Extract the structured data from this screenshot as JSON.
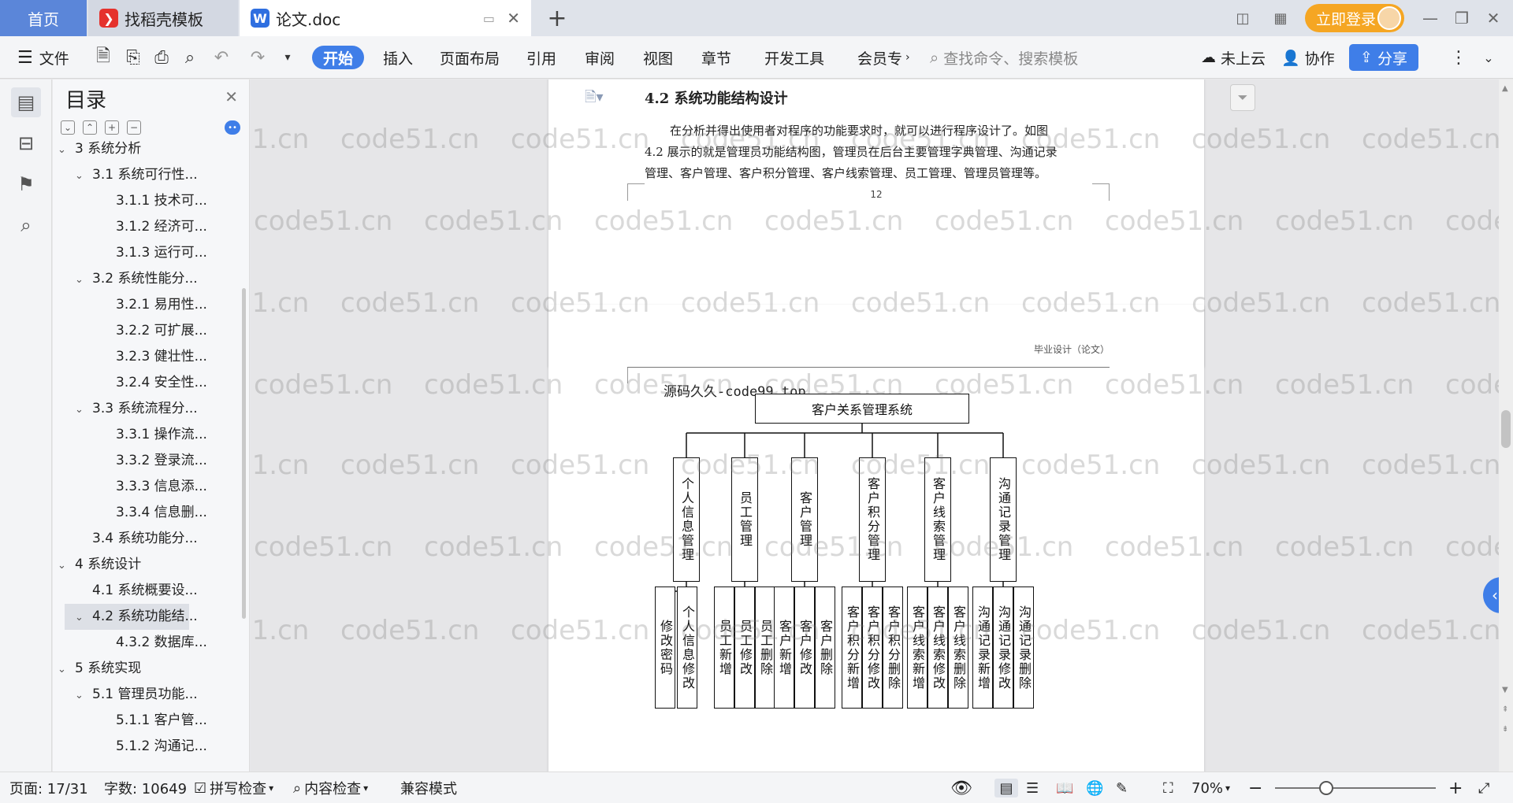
{
  "tabs": {
    "home": "首页",
    "docer": "找稻壳模板",
    "doc": "论文.doc"
  },
  "login": "立即登录",
  "toolbar": {
    "file": "文件",
    "start": "开始",
    "insert": "插入",
    "layout": "页面布局",
    "reference": "引用",
    "review": "审阅",
    "view": "视图",
    "chapter": "章节",
    "devtools": "开发工具",
    "member": "会员专",
    "search_placeholder": "查找命令、搜索模板",
    "cloud": "未上云",
    "collab": "协作",
    "share": "分享"
  },
  "toc": {
    "title": "目录",
    "items": [
      {
        "label": "3  系统分析",
        "level": 1,
        "caret": "v"
      },
      {
        "label": "3.1  系统可行性...",
        "level": 2,
        "caret": "v"
      },
      {
        "label": "3.1.1  技术可...",
        "level": 3,
        "caret": ""
      },
      {
        "label": "3.1.2  经济可...",
        "level": 3,
        "caret": ""
      },
      {
        "label": "3.1.3  运行可...",
        "level": 3,
        "caret": ""
      },
      {
        "label": "3.2  系统性能分...",
        "level": 2,
        "caret": "v"
      },
      {
        "label": "3.2.1  易用性...",
        "level": 3,
        "caret": ""
      },
      {
        "label": "3.2.2  可扩展...",
        "level": 3,
        "caret": ""
      },
      {
        "label": "3.2.3  健壮性...",
        "level": 3,
        "caret": ""
      },
      {
        "label": "3.2.4  安全性...",
        "level": 3,
        "caret": ""
      },
      {
        "label": "3.3  系统流程分...",
        "level": 2,
        "caret": "v"
      },
      {
        "label": "3.3.1  操作流...",
        "level": 3,
        "caret": ""
      },
      {
        "label": "3.3.2  登录流...",
        "level": 3,
        "caret": ""
      },
      {
        "label": "3.3.3  信息添...",
        "level": 3,
        "caret": ""
      },
      {
        "label": "3.3.4  信息删...",
        "level": 3,
        "caret": ""
      },
      {
        "label": "3.4  系统功能分...",
        "level": 2,
        "caret": ""
      },
      {
        "label": "4  系统设计",
        "level": 1,
        "caret": "v"
      },
      {
        "label": "4.1  系统概要设...",
        "level": 2,
        "caret": ""
      },
      {
        "label": "4.2  系统功能结...",
        "level": 2,
        "caret": "v",
        "selected": true
      },
      {
        "label": "4.3.2  数据库...",
        "level": 3,
        "caret": ""
      },
      {
        "label": "5  系统实现",
        "level": 1,
        "caret": "v"
      },
      {
        "label": "5.1  管理员功能...",
        "level": 2,
        "caret": "v"
      },
      {
        "label": "5.1.1  客户管...",
        "level": 3,
        "caret": ""
      },
      {
        "label": "5.1.2  沟通记...",
        "level": 3,
        "caret": ""
      }
    ]
  },
  "document": {
    "section_heading": "4.2  系统功能结构设计",
    "para_lines": [
      "在分析并得出使用者对程序的功能要求时，就可以进行程序设计了。如图",
      "4.2 展示的就是管理员功能结构图，管理员在后台主要管理字典管理、沟通记录",
      "管理、客户管理、客户积分管理、客户线索管理、员工管理、管理员管理等。"
    ],
    "page_number": "12",
    "header_text": "毕业设计（论文）",
    "source_note": "源码久久-code99.top",
    "chart_root": "客户关系管理系统",
    "modules": [
      {
        "label": "个人信息管理",
        "children": [
          "修改密码",
          "个人信息修改"
        ]
      },
      {
        "label": "员工管理",
        "children": [
          "员工新增",
          "员工修改",
          "员工删除"
        ]
      },
      {
        "label": "客户管理",
        "children": [
          "客户新增",
          "客户修改",
          "客户删除"
        ]
      },
      {
        "label": "客户积分管理",
        "children": [
          "客户积分新增",
          "客户积分修改",
          "客户积分删除"
        ]
      },
      {
        "label": "客户线索管理",
        "children": [
          "客户线索新增",
          "客户线索修改",
          "客户线索删除"
        ]
      },
      {
        "label": "沟通记录管理",
        "children": [
          "沟通记录新增",
          "沟通记录修改",
          "沟通记录删除"
        ]
      }
    ]
  },
  "watermark": "code51.cn",
  "status": {
    "page": "页面: 17/31",
    "words": "字数: 10649",
    "spell": "拼写检查",
    "content_check": "内容检查",
    "compat": "兼容模式",
    "zoom": "70%"
  }
}
